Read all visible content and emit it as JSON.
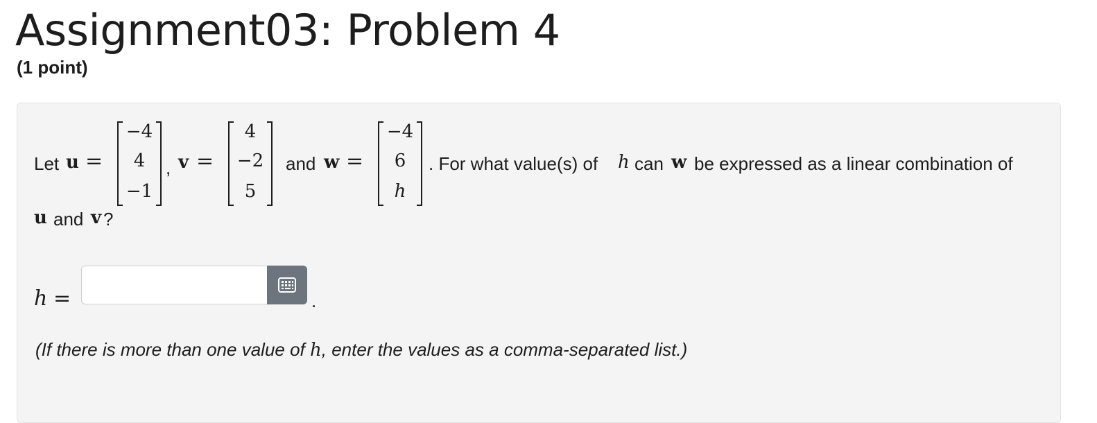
{
  "header": {
    "title": "Assignment03: Problem 4",
    "points": "(1 point)"
  },
  "problem": {
    "let_text": "Let",
    "u_symbol": "u",
    "v_symbol": "v",
    "w_symbol": "w",
    "eq_sign": "=",
    "comma": ",",
    "and_text": "and",
    "u_vector": [
      "−4",
      "4",
      "−1"
    ],
    "v_vector": [
      "4",
      "−2",
      "5"
    ],
    "w_vector": [
      "−4",
      "6",
      "h"
    ],
    "question_a": ". For what value(s) of",
    "h_symbol": "h",
    "question_b": "can",
    "question_c": "be expressed as a linear combination of",
    "line2_and": "and",
    "line2_end": "?"
  },
  "answer": {
    "label_h": "h",
    "label_eq": "=",
    "value": "",
    "placeholder": "",
    "period": ".",
    "editor_icon": "keypad-icon"
  },
  "hint": {
    "before": "(If there is more than one value of",
    "h": "h",
    "after": ", enter the values as a comma-separated list.)"
  }
}
